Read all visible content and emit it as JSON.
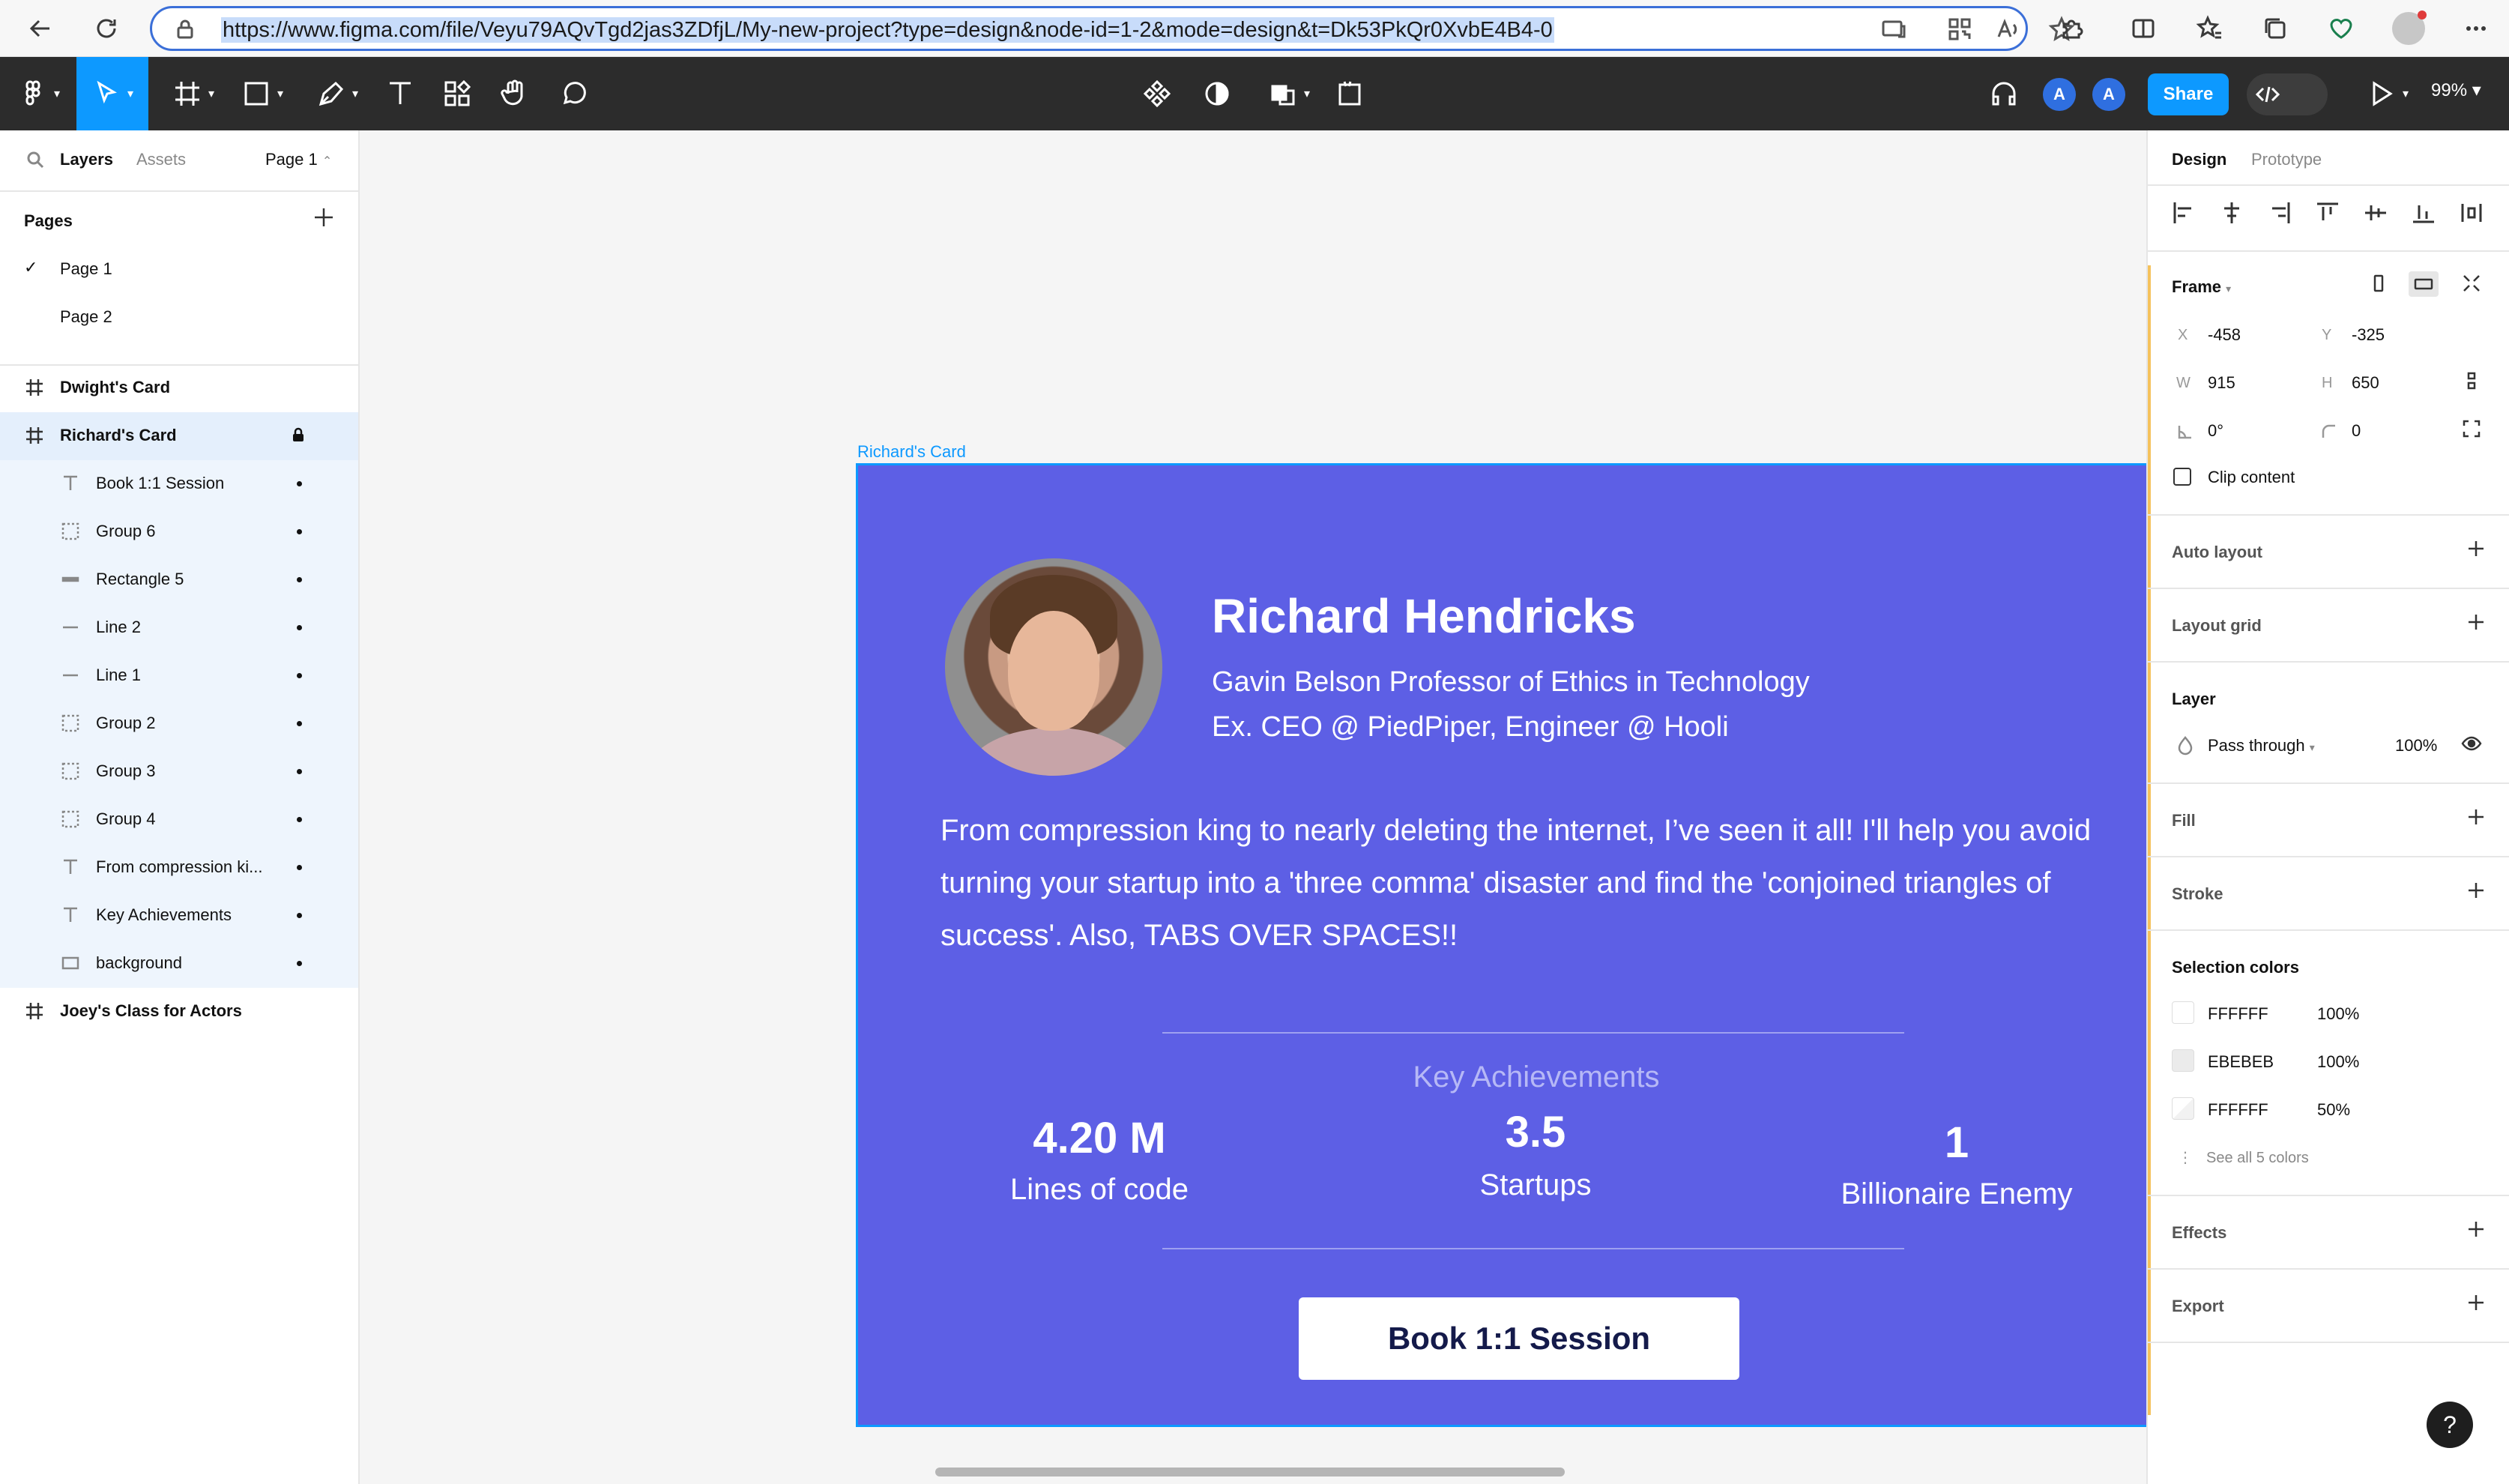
{
  "browser": {
    "url": "https://www.figma.com/file/Veyu79AQvTgd2jas3ZDfjL/My-new-project?type=design&node-id=1-2&mode=design&t=Dk53PkQr0XvbE4B4-0"
  },
  "toolbar": {
    "avatar_1": "A",
    "avatar_2": "A",
    "share_label": "Share",
    "zoom": "99%"
  },
  "left_panel": {
    "tabs": [
      "Layers",
      "Assets"
    ],
    "current_page": "Page 1",
    "pages_title": "Pages",
    "pages": [
      "Page 1",
      "Page 2"
    ],
    "layers": [
      {
        "label": "Dwight's Card",
        "type": "frame"
      },
      {
        "label": "Richard's Card",
        "type": "frame"
      },
      {
        "label": "Book 1:1 Session",
        "type": "text"
      },
      {
        "label": "Group 6",
        "type": "group"
      },
      {
        "label": "Rectangle 5",
        "type": "rect-line"
      },
      {
        "label": "Line 2",
        "type": "line"
      },
      {
        "label": "Line 1",
        "type": "line"
      },
      {
        "label": "Group 2",
        "type": "group"
      },
      {
        "label": "Group 3",
        "type": "group"
      },
      {
        "label": "Group 4",
        "type": "group"
      },
      {
        "label": "From compression ki...",
        "type": "text"
      },
      {
        "label": "Key Achievements",
        "type": "text"
      },
      {
        "label": "background",
        "type": "rect"
      },
      {
        "label": "Joey's Class for Actors",
        "type": "frame"
      }
    ]
  },
  "canvas": {
    "frame_label": "Richard's Card",
    "card": {
      "name": "Richard Hendricks",
      "role_line_1": "Gavin Belson Professor of Ethics in Technology",
      "role_line_2": "Ex. CEO @ PiedPiper, Engineer @ Hooli",
      "bio": "From compression king to nearly deleting the internet, I’ve seen it all! I'll help you avoid turning your startup into a 'three comma' disaster and find the 'conjoined triangles of success'. Also, TABS OVER SPACES!!",
      "achievements_title": "Key Achievements",
      "stats": [
        {
          "value": "4.20 M",
          "label": "Lines of code"
        },
        {
          "value": "3.5",
          "label": "Startups"
        },
        {
          "value": "1",
          "label": "Billionaire Enemy"
        }
      ],
      "cta": "Book 1:1 Session",
      "background_color": "#5D5FE5"
    }
  },
  "right_panel": {
    "tabs": [
      "Design",
      "Prototype"
    ],
    "frame_label": "Frame",
    "x_label": "X",
    "x": "-458",
    "y_label": "Y",
    "y": "-325",
    "w_label": "W",
    "w": "915",
    "h_label": "H",
    "h": "650",
    "rotation": "0°",
    "radius": "0",
    "clip_content": "Clip content",
    "auto_layout": "Auto layout",
    "layout_grid": "Layout grid",
    "layer_title": "Layer",
    "blend_mode": "Pass through",
    "opacity": "100%",
    "fill": "Fill",
    "stroke": "Stroke",
    "selection_colors_title": "Selection colors",
    "selection_colors": [
      {
        "hex": "FFFFFF",
        "opacity": "100%",
        "swatch": "#FFFFFF"
      },
      {
        "hex": "EBEBEB",
        "opacity": "100%",
        "swatch": "#EBEBEB"
      },
      {
        "hex": "FFFFFF",
        "opacity": "50%",
        "swatch": "#FFFFFF"
      }
    ],
    "see_all_colors": "See all 5 colors",
    "effects": "Effects",
    "export": "Export",
    "help": "?"
  }
}
